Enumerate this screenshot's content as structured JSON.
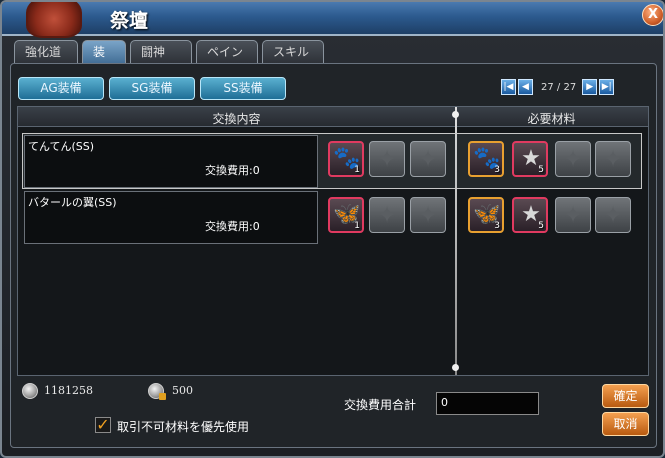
{
  "window": {
    "title": "祭壇",
    "close_label": "X"
  },
  "tabs": [
    "強化道具",
    "装備",
    "闘神",
    "ペイン",
    "スキル"
  ],
  "grade_buttons": [
    "AG装備",
    "SG装備",
    "SS装備"
  ],
  "pager": {
    "first": "|◀",
    "prev": "◀",
    "text": "27 / 27",
    "next": "▶",
    "last": "▶|"
  },
  "table": {
    "header_left": "交換内容",
    "header_right": "必要材料",
    "rows": [
      {
        "name": "てんてん(SS)",
        "cost_label": "交換費用:0",
        "reward_qty": "1",
        "material_qtys": [
          "3",
          "5"
        ]
      },
      {
        "name": "バタールの翼(SS)",
        "cost_label": "交換費用:0",
        "reward_qty": "1",
        "material_qtys": [
          "3",
          "5"
        ]
      }
    ]
  },
  "currency": {
    "coins": "1181258",
    "locked_coins": "500"
  },
  "checkbox": {
    "label": "取引不可材料を優先使用",
    "checked": true
  },
  "total": {
    "label": "交換費用合計",
    "value": "0"
  },
  "buttons": {
    "confirm": "確定",
    "cancel": "取消"
  },
  "icons": {
    "portrait": "character-portrait-icon",
    "coin": "silver-coin-icon",
    "locked_coin": "locked-coin-icon",
    "star": "star-icon",
    "pet": "pet-icon",
    "wing": "wing-icon"
  }
}
